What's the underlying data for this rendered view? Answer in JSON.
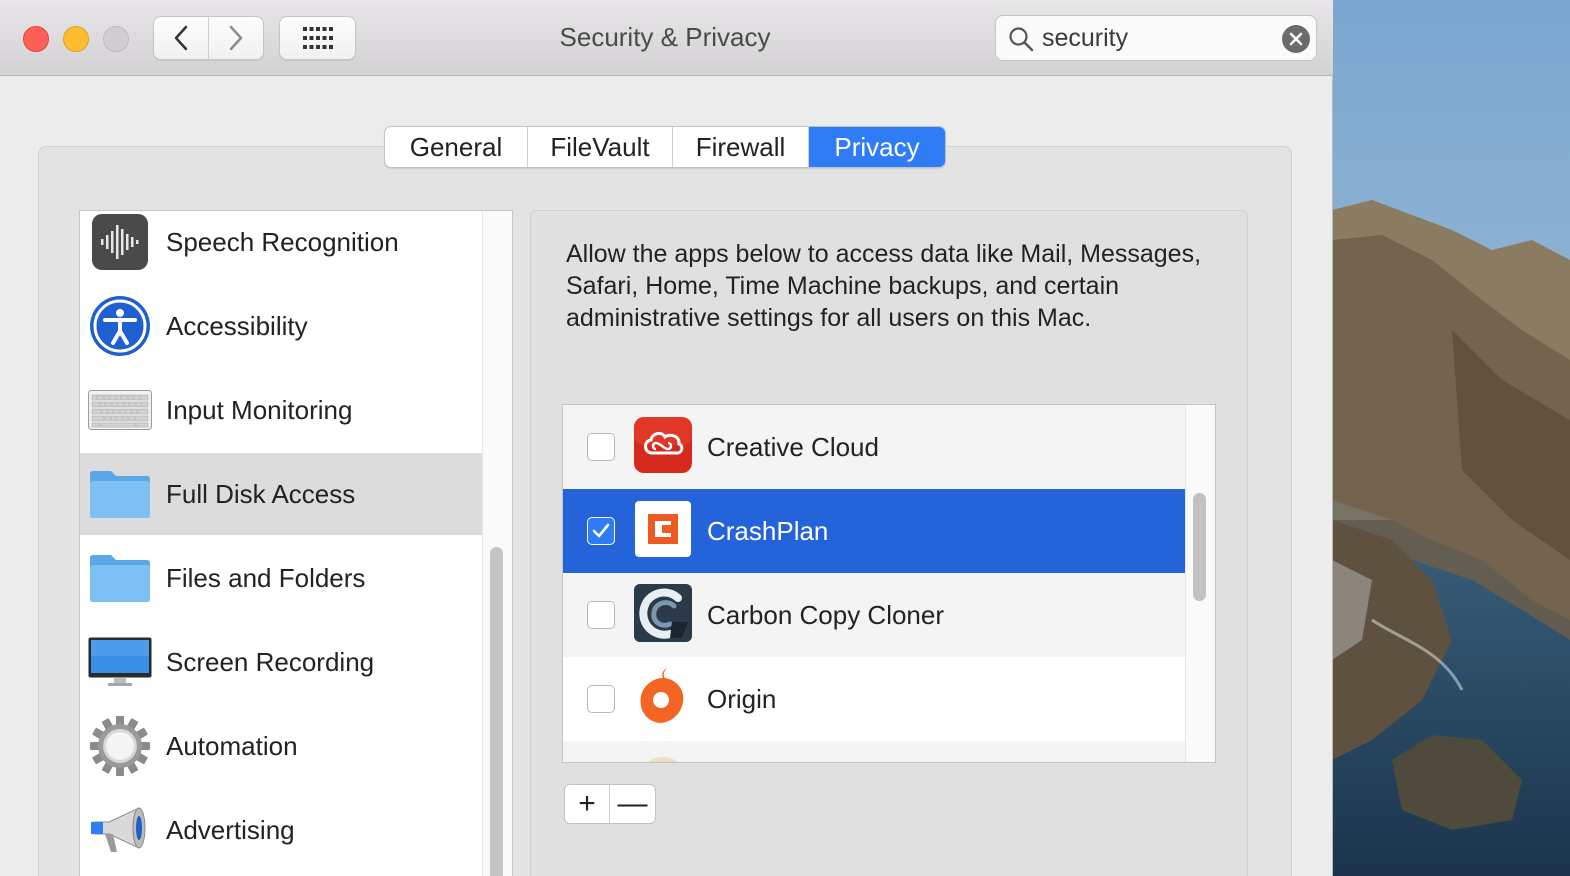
{
  "window": {
    "title": "Security & Privacy"
  },
  "search": {
    "value": "security",
    "placeholder": "Search"
  },
  "tabs": [
    {
      "label": "General",
      "active": false
    },
    {
      "label": "FileVault",
      "active": false
    },
    {
      "label": "Firewall",
      "active": false
    },
    {
      "label": "Privacy",
      "active": true
    }
  ],
  "categories": [
    {
      "label": "Speech Recognition",
      "icon": "waveform-icon"
    },
    {
      "label": "Accessibility",
      "icon": "accessibility-icon"
    },
    {
      "label": "Input Monitoring",
      "icon": "keyboard-icon"
    },
    {
      "label": "Full Disk Access",
      "icon": "folder-icon",
      "selected": true
    },
    {
      "label": "Files and Folders",
      "icon": "folder-icon"
    },
    {
      "label": "Screen Recording",
      "icon": "display-icon"
    },
    {
      "label": "Automation",
      "icon": "gear-icon"
    },
    {
      "label": "Advertising",
      "icon": "megaphone-icon"
    }
  ],
  "detail": {
    "description": "Allow the apps below to access data like Mail, Messages, Safari, Home, Time Machine backups, and certain administrative settings for all users on this Mac."
  },
  "apps": [
    {
      "label": "Creative Cloud",
      "checked": false
    },
    {
      "label": "CrashPlan",
      "checked": true,
      "selected": true
    },
    {
      "label": "Carbon Copy Cloner",
      "checked": false
    },
    {
      "label": "Origin",
      "checked": false
    }
  ],
  "buttons": {
    "add": "+",
    "remove": "—"
  },
  "colors": {
    "accent": "#2f7cf6",
    "selection": "#2463d9"
  }
}
